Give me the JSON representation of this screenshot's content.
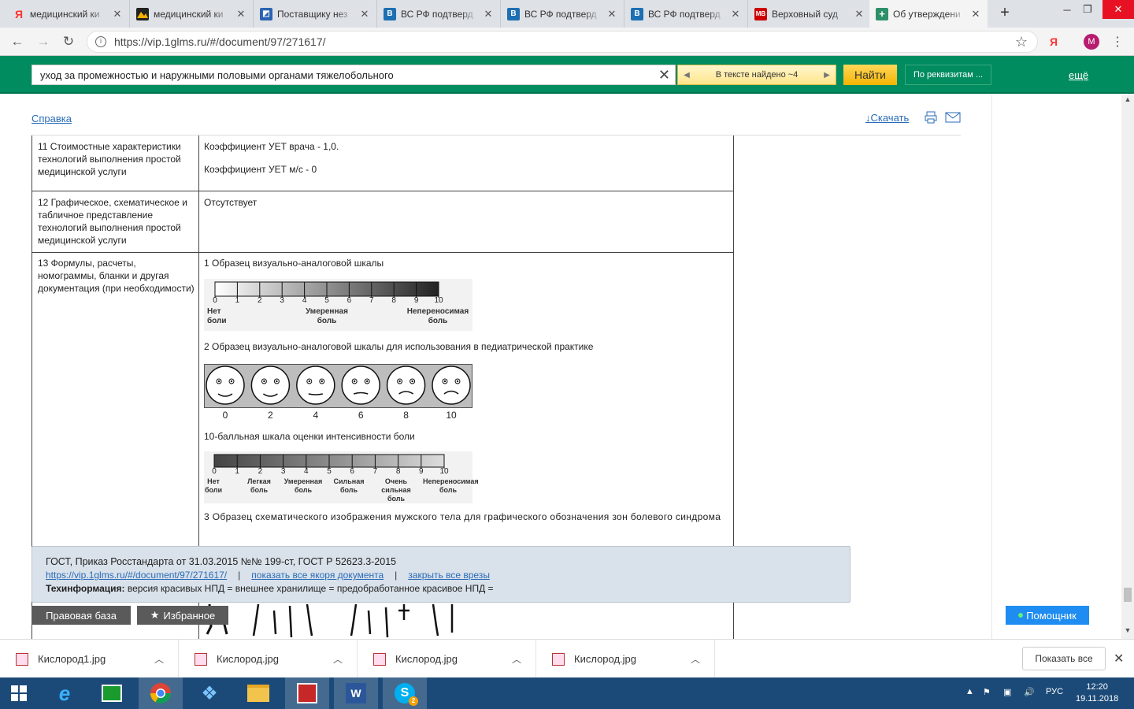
{
  "browser": {
    "tabs": [
      {
        "title": "медицинский ки",
        "favicon": "yandex-icon",
        "color": "#f33"
      },
      {
        "title": "медицинский ки",
        "favicon": "image-icon",
        "color": "#f90"
      },
      {
        "title": "Поставщику нез",
        "favicon": "site-icon",
        "color": "#2a64b0"
      },
      {
        "title": "ВС РФ подтверд",
        "favicon": "site-icon",
        "color": "#1d6fb3"
      },
      {
        "title": "ВС РФ подтверд",
        "favicon": "site-icon",
        "color": "#1d6fb3"
      },
      {
        "title": "ВС РФ подтверд",
        "favicon": "site-icon",
        "color": "#1d6fb3"
      },
      {
        "title": "Верховный суд",
        "favicon": "site-icon",
        "color": "#c00"
      },
      {
        "title": "Об утверждени",
        "favicon": "plus-icon",
        "color": "#2d9068",
        "active": true
      }
    ],
    "url": "https://vip.1glms.ru/#/document/97/271617/",
    "profile_initial": "M"
  },
  "searchbar": {
    "query": "уход за промежностью и наружными половыми органами тяжелобольного",
    "found": "В тексте найдено ~4",
    "find_label": "Найти",
    "requisites_label": "По реквизитам ...",
    "more_label": "ещё"
  },
  "page": {
    "help_label": "Справка",
    "download_label": "Скачать"
  },
  "table": {
    "rows": [
      {
        "label": "11 Стоимостные характеристики технологий выполнения простой медицинской услуги",
        "value1": "Коэффициент УЕТ врача - 1,0.",
        "value2": "Коэффициент УЕТ м/с - 0"
      },
      {
        "label": "12 Графическое, схематическое и табличное представление технологий выполнения простой медицинской услуги",
        "value1": "Отсутствует"
      },
      {
        "label": "13 Формулы, расчеты, номограммы, бланки и другая документация (при необходимости)",
        "caption1": "1 Образец визуально-аналоговой шкалы",
        "caption2": "2 Образец визуально-аналоговой шкалы для использования в педиатрической практике",
        "caption3": "10-балльная шкала оценки интенсивности боли",
        "caption4": "3 Образец схематического изображения мужского тела для графического обозначения зон болевого синдрома"
      }
    ]
  },
  "vas_scale": {
    "ticks": [
      "0",
      "1",
      "2",
      "3",
      "4",
      "5",
      "6",
      "7",
      "8",
      "9",
      "10"
    ],
    "label_left": "Нет",
    "label_left2": "боли",
    "label_mid": "Умеренная",
    "label_mid2": "боль",
    "label_right": "Непереносимая",
    "label_right2": "боль"
  },
  "faces_scale": {
    "ticks": [
      "0",
      "2",
      "4",
      "6",
      "8",
      "10"
    ]
  },
  "ten_scale": {
    "ticks": [
      "0",
      "1",
      "2",
      "3",
      "4",
      "5",
      "6",
      "7",
      "8",
      "9",
      "10"
    ],
    "labels": [
      {
        "l1": "Нет",
        "l2": "боли"
      },
      {
        "l1": "Легкая",
        "l2": "боль"
      },
      {
        "l1": "Умеренная",
        "l2": "боль"
      },
      {
        "l1": "Сильная",
        "l2": "боль"
      },
      {
        "l1": "Очень",
        "l2": "сильная боль"
      },
      {
        "l1": "Непереносимая",
        "l2": "боль"
      }
    ]
  },
  "infopanel": {
    "title": "ГОСТ, Приказ Росстандарта от 31.03.2015 №№ 199-ст, ГОСТ Р 52623.3-2015",
    "link_url": "https://vip.1glms.ru/#/document/97/271617/",
    "link_anchors": "показать все якоря документа",
    "link_close": "закрыть все врезы",
    "tech_label": "Техинформация:",
    "tech_text": "версия красивых НПД = внешнее хранилище = предобработанное красивое НПД ="
  },
  "panel_buttons": {
    "legal_base": "Правовая база",
    "favorites": "Избранное",
    "assistant": "Помощник"
  },
  "downloads": {
    "files": [
      "Кислород1.jpg",
      "Кислород.jpg",
      "Кислород.jpg",
      "Кислород.jpg"
    ],
    "show_all": "Показать все"
  },
  "taskbar": {
    "lang": "РУС",
    "time": "12:20",
    "date": "19.11.2018",
    "skype_badge": "2"
  }
}
